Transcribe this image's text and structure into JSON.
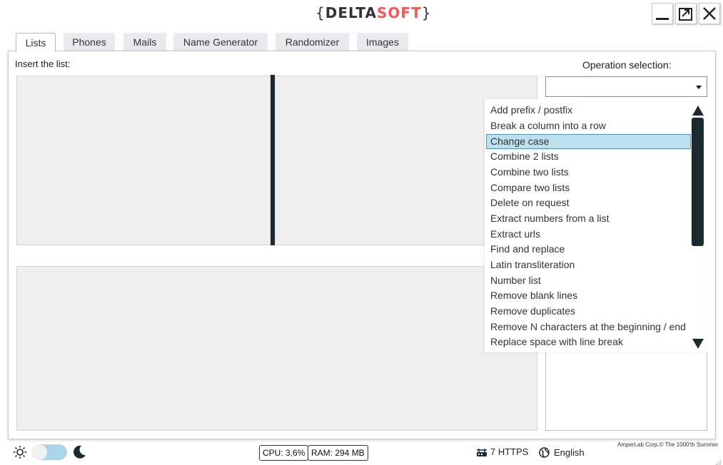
{
  "logo": {
    "open": "{",
    "part1": "DELTA",
    "part2": "SOFT",
    "close": "}"
  },
  "tabs": [
    {
      "label": "Lists",
      "active": true
    },
    {
      "label": "Phones",
      "active": false
    },
    {
      "label": "Mails",
      "active": false
    },
    {
      "label": "Name Generator",
      "active": false
    },
    {
      "label": "Randomizer",
      "active": false
    },
    {
      "label": "Images",
      "active": false
    }
  ],
  "main": {
    "insert_label": "Insert the list:",
    "operation_label": "Operation selection:",
    "combo_value": ""
  },
  "dropdown": {
    "selected_index": 2,
    "items": [
      "Add prefix / postfix",
      "Break a column into a row",
      "Change case",
      "Combine 2 lists",
      "Combine two lists",
      "Compare two lists",
      "Delete on request",
      "Extract numbers from a list",
      "Extract urls",
      "Find and replace",
      "Latin transliteration",
      "Number list",
      "Remove blank lines",
      "Remove duplicates",
      "Remove N characters at the beginning / end",
      "Replace space with line break"
    ]
  },
  "footer": {
    "cpu": "CPU: 3,6%",
    "ram": "RAM: 294 MB",
    "proxies": "7 HTTPS",
    "language": "English",
    "copyright": "AmperLab Corp.© The 1000'th Summer"
  },
  "colors": {
    "accent": "#f15a5a",
    "dark": "#1b2a30",
    "selection": "#bde0ef",
    "toggle": "#a9d5e8"
  }
}
